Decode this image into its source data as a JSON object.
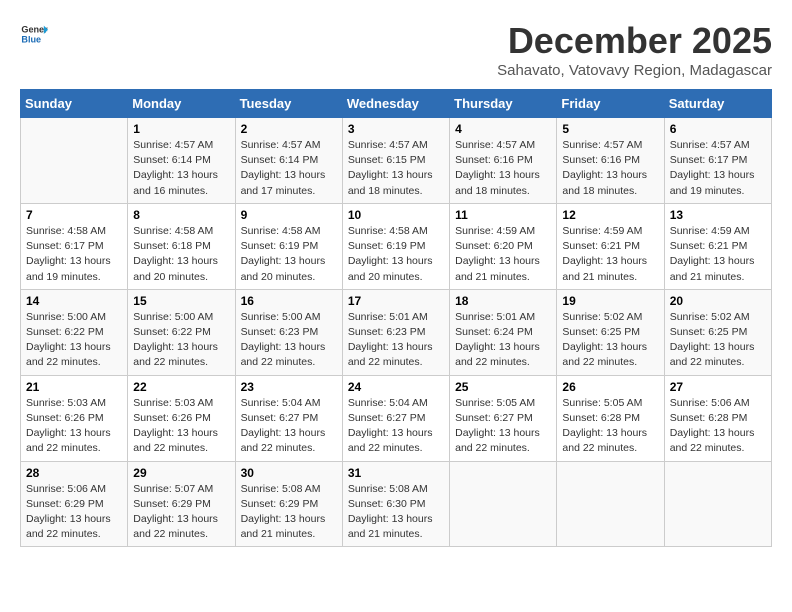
{
  "logo": {
    "line1": "General",
    "line2": "Blue"
  },
  "title": "December 2025",
  "subtitle": "Sahavato, Vatovavy Region, Madagascar",
  "weekdays": [
    "Sunday",
    "Monday",
    "Tuesday",
    "Wednesday",
    "Thursday",
    "Friday",
    "Saturday"
  ],
  "weeks": [
    [
      {
        "day": "",
        "sunrise": "",
        "sunset": "",
        "daylight": ""
      },
      {
        "day": "1",
        "sunrise": "Sunrise: 4:57 AM",
        "sunset": "Sunset: 6:14 PM",
        "daylight": "Daylight: 13 hours and 16 minutes."
      },
      {
        "day": "2",
        "sunrise": "Sunrise: 4:57 AM",
        "sunset": "Sunset: 6:14 PM",
        "daylight": "Daylight: 13 hours and 17 minutes."
      },
      {
        "day": "3",
        "sunrise": "Sunrise: 4:57 AM",
        "sunset": "Sunset: 6:15 PM",
        "daylight": "Daylight: 13 hours and 18 minutes."
      },
      {
        "day": "4",
        "sunrise": "Sunrise: 4:57 AM",
        "sunset": "Sunset: 6:16 PM",
        "daylight": "Daylight: 13 hours and 18 minutes."
      },
      {
        "day": "5",
        "sunrise": "Sunrise: 4:57 AM",
        "sunset": "Sunset: 6:16 PM",
        "daylight": "Daylight: 13 hours and 18 minutes."
      },
      {
        "day": "6",
        "sunrise": "Sunrise: 4:57 AM",
        "sunset": "Sunset: 6:17 PM",
        "daylight": "Daylight: 13 hours and 19 minutes."
      }
    ],
    [
      {
        "day": "7",
        "sunrise": "Sunrise: 4:58 AM",
        "sunset": "Sunset: 6:17 PM",
        "daylight": "Daylight: 13 hours and 19 minutes."
      },
      {
        "day": "8",
        "sunrise": "Sunrise: 4:58 AM",
        "sunset": "Sunset: 6:18 PM",
        "daylight": "Daylight: 13 hours and 20 minutes."
      },
      {
        "day": "9",
        "sunrise": "Sunrise: 4:58 AM",
        "sunset": "Sunset: 6:19 PM",
        "daylight": "Daylight: 13 hours and 20 minutes."
      },
      {
        "day": "10",
        "sunrise": "Sunrise: 4:58 AM",
        "sunset": "Sunset: 6:19 PM",
        "daylight": "Daylight: 13 hours and 20 minutes."
      },
      {
        "day": "11",
        "sunrise": "Sunrise: 4:59 AM",
        "sunset": "Sunset: 6:20 PM",
        "daylight": "Daylight: 13 hours and 21 minutes."
      },
      {
        "day": "12",
        "sunrise": "Sunrise: 4:59 AM",
        "sunset": "Sunset: 6:21 PM",
        "daylight": "Daylight: 13 hours and 21 minutes."
      },
      {
        "day": "13",
        "sunrise": "Sunrise: 4:59 AM",
        "sunset": "Sunset: 6:21 PM",
        "daylight": "Daylight: 13 hours and 21 minutes."
      }
    ],
    [
      {
        "day": "14",
        "sunrise": "Sunrise: 5:00 AM",
        "sunset": "Sunset: 6:22 PM",
        "daylight": "Daylight: 13 hours and 22 minutes."
      },
      {
        "day": "15",
        "sunrise": "Sunrise: 5:00 AM",
        "sunset": "Sunset: 6:22 PM",
        "daylight": "Daylight: 13 hours and 22 minutes."
      },
      {
        "day": "16",
        "sunrise": "Sunrise: 5:00 AM",
        "sunset": "Sunset: 6:23 PM",
        "daylight": "Daylight: 13 hours and 22 minutes."
      },
      {
        "day": "17",
        "sunrise": "Sunrise: 5:01 AM",
        "sunset": "Sunset: 6:23 PM",
        "daylight": "Daylight: 13 hours and 22 minutes."
      },
      {
        "day": "18",
        "sunrise": "Sunrise: 5:01 AM",
        "sunset": "Sunset: 6:24 PM",
        "daylight": "Daylight: 13 hours and 22 minutes."
      },
      {
        "day": "19",
        "sunrise": "Sunrise: 5:02 AM",
        "sunset": "Sunset: 6:25 PM",
        "daylight": "Daylight: 13 hours and 22 minutes."
      },
      {
        "day": "20",
        "sunrise": "Sunrise: 5:02 AM",
        "sunset": "Sunset: 6:25 PM",
        "daylight": "Daylight: 13 hours and 22 minutes."
      }
    ],
    [
      {
        "day": "21",
        "sunrise": "Sunrise: 5:03 AM",
        "sunset": "Sunset: 6:26 PM",
        "daylight": "Daylight: 13 hours and 22 minutes."
      },
      {
        "day": "22",
        "sunrise": "Sunrise: 5:03 AM",
        "sunset": "Sunset: 6:26 PM",
        "daylight": "Daylight: 13 hours and 22 minutes."
      },
      {
        "day": "23",
        "sunrise": "Sunrise: 5:04 AM",
        "sunset": "Sunset: 6:27 PM",
        "daylight": "Daylight: 13 hours and 22 minutes."
      },
      {
        "day": "24",
        "sunrise": "Sunrise: 5:04 AM",
        "sunset": "Sunset: 6:27 PM",
        "daylight": "Daylight: 13 hours and 22 minutes."
      },
      {
        "day": "25",
        "sunrise": "Sunrise: 5:05 AM",
        "sunset": "Sunset: 6:27 PM",
        "daylight": "Daylight: 13 hours and 22 minutes."
      },
      {
        "day": "26",
        "sunrise": "Sunrise: 5:05 AM",
        "sunset": "Sunset: 6:28 PM",
        "daylight": "Daylight: 13 hours and 22 minutes."
      },
      {
        "day": "27",
        "sunrise": "Sunrise: 5:06 AM",
        "sunset": "Sunset: 6:28 PM",
        "daylight": "Daylight: 13 hours and 22 minutes."
      }
    ],
    [
      {
        "day": "28",
        "sunrise": "Sunrise: 5:06 AM",
        "sunset": "Sunset: 6:29 PM",
        "daylight": "Daylight: 13 hours and 22 minutes."
      },
      {
        "day": "29",
        "sunrise": "Sunrise: 5:07 AM",
        "sunset": "Sunset: 6:29 PM",
        "daylight": "Daylight: 13 hours and 22 minutes."
      },
      {
        "day": "30",
        "sunrise": "Sunrise: 5:08 AM",
        "sunset": "Sunset: 6:29 PM",
        "daylight": "Daylight: 13 hours and 21 minutes."
      },
      {
        "day": "31",
        "sunrise": "Sunrise: 5:08 AM",
        "sunset": "Sunset: 6:30 PM",
        "daylight": "Daylight: 13 hours and 21 minutes."
      },
      {
        "day": "",
        "sunrise": "",
        "sunset": "",
        "daylight": ""
      },
      {
        "day": "",
        "sunrise": "",
        "sunset": "",
        "daylight": ""
      },
      {
        "day": "",
        "sunrise": "",
        "sunset": "",
        "daylight": ""
      }
    ]
  ]
}
